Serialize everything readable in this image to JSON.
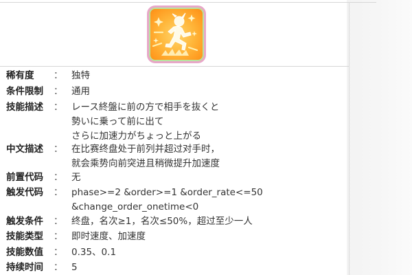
{
  "skill": {
    "icon_name": "running-burst-icon",
    "icon_colors": {
      "primary": "#ffb63a",
      "border": "#e8a7c9",
      "inner_border": "#b8e4a0"
    }
  },
  "rows": [
    {
      "label": "稀有度",
      "colon": "：",
      "lines": [
        "独特"
      ]
    },
    {
      "label": "条件限制",
      "colon": "：",
      "lines": [
        "通用"
      ]
    },
    {
      "label": "技能描述",
      "colon": "：",
      "lines": [
        "レース終盤に前の方で相手を抜くと",
        "勢いに乗って前に出て",
        "さらに加速力がちょっと上がる"
      ]
    },
    {
      "label": "中文描述",
      "colon": "：",
      "lines": [
        "在比赛终盘处于前列并超过对手时，",
        "就会乘势向前突进且稍微提升加速度"
      ]
    },
    {
      "label": "前置代码",
      "colon": "：",
      "lines": [
        "无"
      ]
    },
    {
      "label": "触发代码",
      "colon": "：",
      "lines": [
        "phase>=2 &order>=1 &order_rate<=50",
        "&change_order_onetime<0"
      ]
    },
    {
      "label": "触发条件",
      "colon": "：",
      "lines": [
        "终盘，名次≥1，名次≤50%，超过至少一人"
      ]
    },
    {
      "label": "技能类型",
      "colon": "：",
      "lines": [
        "即时速度、加速度"
      ]
    },
    {
      "label": "技能数值",
      "colon": "：",
      "lines": [
        "0.35、0.1"
      ]
    },
    {
      "label": "持续时间",
      "colon": "：",
      "lines": [
        "5"
      ]
    }
  ]
}
